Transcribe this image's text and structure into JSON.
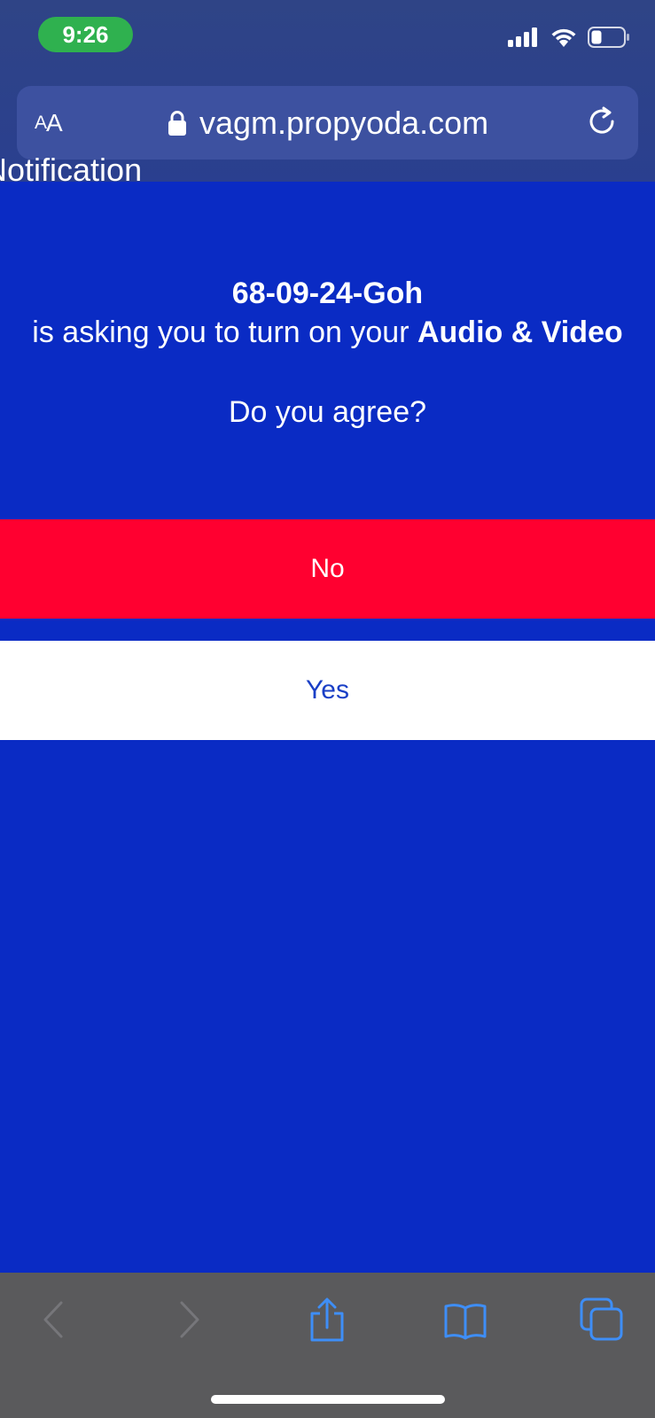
{
  "status_bar": {
    "time": "9:26",
    "pill_color": "#2fb14f",
    "icons": [
      "cellular-signal-icon",
      "wifi-icon",
      "battery-icon"
    ]
  },
  "browser": {
    "text_size_label_small": "A",
    "text_size_label_large": "A",
    "url": "vagm.propyoda.com",
    "url_icon": "lock-icon",
    "reload_icon": "reload-icon",
    "chrome_color": "#2a3f8f"
  },
  "page": {
    "background_color": "#0a2bc4",
    "partial_heading": "Notification",
    "requester": "68-09-24-Goh",
    "ask_prefix": "is asking you to turn on your ",
    "ask_emphasis": "Audio & Video",
    "question": "Do you agree?",
    "no_label": "No",
    "no_color": "#ff0030",
    "yes_label": "Yes",
    "yes_color": "#ffffff"
  },
  "toolbar": {
    "icons": [
      "back-arrow-icon",
      "forward-arrow-icon",
      "share-icon",
      "bookmarks-icon",
      "tabs-icon"
    ],
    "background_color": "#5a5a5c"
  }
}
